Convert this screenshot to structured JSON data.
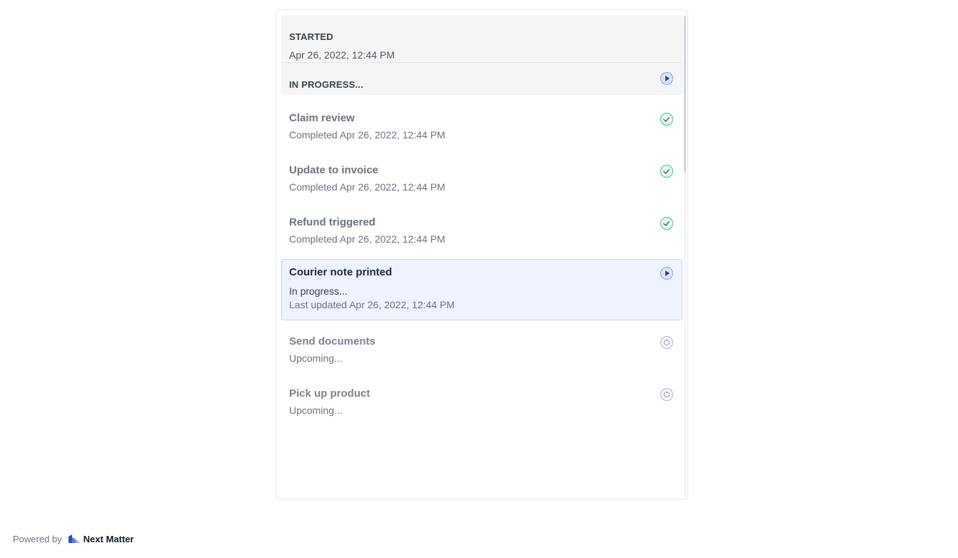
{
  "summary": {
    "started_label": "STARTED",
    "started_date": "Apr 26, 2022, 12:44 PM",
    "progress_label": "IN PROGRESS...",
    "progress_icon": "play-icon"
  },
  "steps": [
    {
      "title": "Claim review",
      "line1": "Completed Apr 26, 2022, 12:44 PM",
      "status": "completed",
      "icon": "check-circle-icon"
    },
    {
      "title": "Update to invoice",
      "line1": "Completed Apr 26, 2022, 12:44 PM",
      "status": "completed",
      "icon": "check-circle-icon"
    },
    {
      "title": "Refund triggered",
      "line1": "Completed Apr 26, 2022, 12:44 PM",
      "status": "completed",
      "icon": "check-circle-icon"
    },
    {
      "title": "Courier note printed",
      "line1": "In progress...",
      "line2": "Last updated Apr 26, 2022, 12:44 PM",
      "status": "in_progress",
      "icon": "play-icon"
    },
    {
      "title": "Send documents",
      "line1": "Upcoming...",
      "status": "upcoming",
      "icon": "pending-dots-icon"
    },
    {
      "title": "Pick up product",
      "line1": "Upcoming...",
      "status": "upcoming",
      "icon": "pending-dots-icon"
    }
  ],
  "footer": {
    "powered_by": "Powered by",
    "brand": "Next Matter",
    "logo_icon": "next-matter-logo-icon"
  },
  "colors": {
    "completed": "#34c37a",
    "in_progress": "#2b3f7a",
    "active_row_bg": "#eef3fd",
    "summary_bg": "#f4f5f5"
  }
}
